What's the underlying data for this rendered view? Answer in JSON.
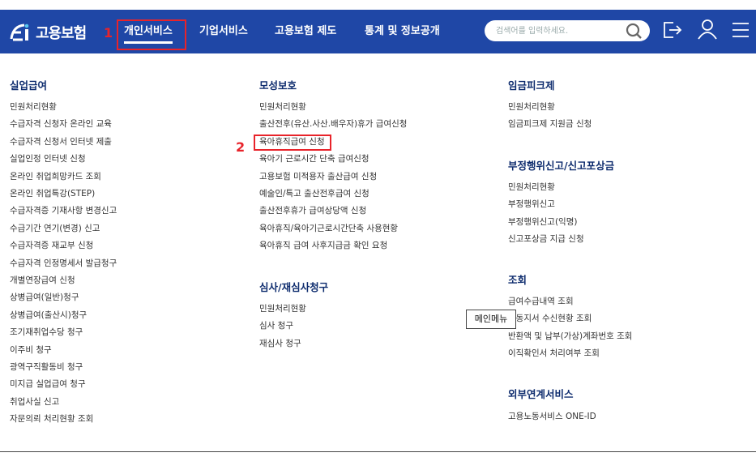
{
  "header": {
    "logo_text": "고용보험",
    "marker_1": "1",
    "nav": [
      {
        "label": "개인서비스"
      },
      {
        "label": "기업서비스"
      },
      {
        "label": "고용보험 제도"
      },
      {
        "label": "통계 및 정보공개"
      }
    ],
    "search_placeholder": "검색어를 입력하세요."
  },
  "col1": {
    "title": "실업급여",
    "items": [
      "민원처리현황",
      "수급자격 신청자 온라인 교육",
      "수급자격 신청서 인터넷 제출",
      "실업인정 인터넷 신청",
      "온라인 취업희망카드 조회",
      "온라인 취업특강(STEP)",
      "수급자격증 기재사항 변경신고",
      "수급기간 연기(변경) 신고",
      "수급자격증 재교부 신청",
      "수급자격 인정명세서 발급청구",
      "개별연장급여 신청",
      "상병급여(일반)청구",
      "상병급여(출산시)청구",
      "조기재취업수당 청구",
      "이주비 청구",
      "광역구직활동비 청구",
      "미지급 실업급여 청구",
      "취업사실 신고",
      "자문의뢰 처리현황 조회"
    ]
  },
  "col2": {
    "title": "모성보호",
    "marker_2": "2",
    "items": [
      "민원처리현황",
      "출산전후(유산.사산.배우자)휴가 급여신청",
      "육아휴직급여 신청",
      "육아기 근로시간 단축 급여신청",
      "고용보험 미적용자 출산급여 신청",
      "예술인/특고 출산전후급여 신청",
      "출산전후휴가 급여상당액 신청",
      "육아휴직/육아기근로시간단축 사용현황",
      "육아휴직 급여 사후지급금 확인 요청"
    ],
    "title2": "심사/재심사청구",
    "items2": [
      "민원처리현황",
      "심사 청구",
      "재심사 청구"
    ]
  },
  "col3": {
    "title1": "임금피크제",
    "items1": [
      "민원처리현황",
      "임금피크제 지원금 신청"
    ],
    "title2": "부정행위신고/신고포상금",
    "items2": [
      "민원처리현황",
      "부정행위신고",
      "부정행위신고(익명)",
      "신고포상금 지급 신청"
    ],
    "title3": "조회",
    "items3": [
      "급여수급내역 조회",
      "자동지서 수신현황 조회",
      "반환액 및 납부(가상)계좌번호 조회",
      "이직확인서 처리여부 조회"
    ],
    "title4": "외부연계서비스",
    "items4": [
      "고용노동서비스 ONE-ID"
    ]
  },
  "tooltip": "메인메뉴",
  "colors": {
    "header_bg": "#1f47a6",
    "title": "#0e2c6e",
    "highlight": "#e8232a"
  }
}
